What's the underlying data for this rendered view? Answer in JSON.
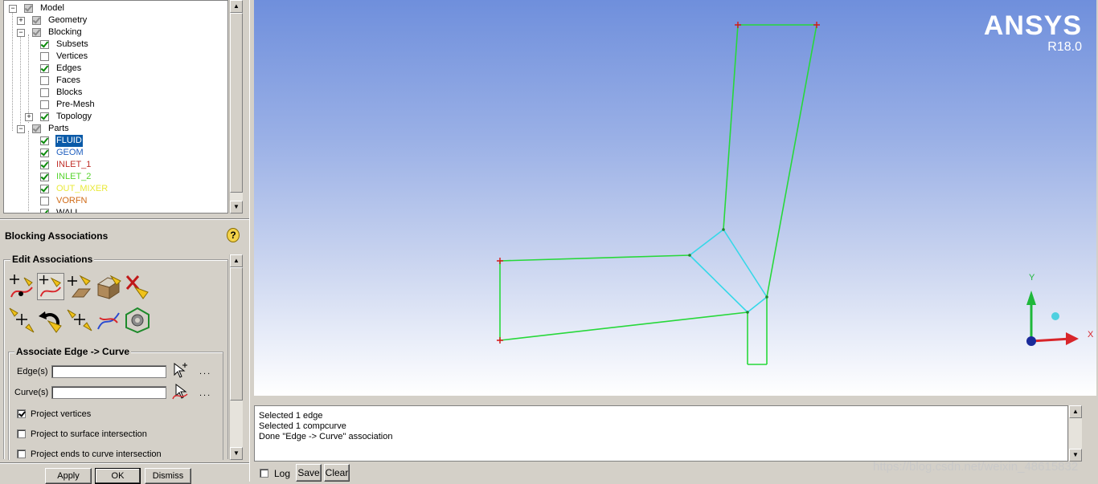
{
  "tree": {
    "items": [
      {
        "label": "Model"
      },
      {
        "label": "Geometry"
      },
      {
        "label": "Blocking"
      },
      {
        "label": "Subsets"
      },
      {
        "label": "Vertices"
      },
      {
        "label": "Edges"
      },
      {
        "label": "Faces"
      },
      {
        "label": "Blocks"
      },
      {
        "label": "Pre-Mesh"
      },
      {
        "label": "Topology"
      },
      {
        "label": "Parts"
      },
      {
        "label": "FLUID",
        "color": "#ffffff"
      },
      {
        "label": "GEOM",
        "color": "#1f5fbf"
      },
      {
        "label": "INLET_1",
        "color": "#c0302a"
      },
      {
        "label": "INLET_2",
        "color": "#57d42f"
      },
      {
        "label": "OUT_MIXER",
        "color": "#ffff33"
      },
      {
        "label": "VORFN",
        "color": "#d06a16"
      },
      {
        "label": "WALL"
      }
    ]
  },
  "panel": {
    "title": "Blocking Associations",
    "edit_group": "Edit Associations",
    "assoc_group": "Associate Edge -> Curve",
    "edges_label": "Edge(s)",
    "curves_label": "Curve(s)",
    "edges_value": "",
    "curves_value": "",
    "dots": "...",
    "options": [
      {
        "label": "Project vertices",
        "checked": true
      },
      {
        "label": "Project to surface intersection",
        "checked": false
      },
      {
        "label": "Project ends to curve intersection",
        "checked": false
      }
    ],
    "apply": "Apply",
    "ok": "OK",
    "dismiss": "Dismiss"
  },
  "viewport": {
    "brand": "ANSYS",
    "version": "R18.0",
    "axis_x": "X",
    "axis_y": "Y"
  },
  "messages": [
    "Selected 1 edge",
    "Selected 1 compcurve",
    "Done \"Edge -> Curve\" association"
  ],
  "bottom": {
    "log": "Log",
    "save": "Save",
    "clear": "Clear"
  },
  "watermark": "https://blog.csdn.net/weixin_48615832",
  "colors": {
    "edge_green": "#27d83a",
    "edge_cyan": "#35d8e8",
    "selection": "#0a5aa8"
  }
}
